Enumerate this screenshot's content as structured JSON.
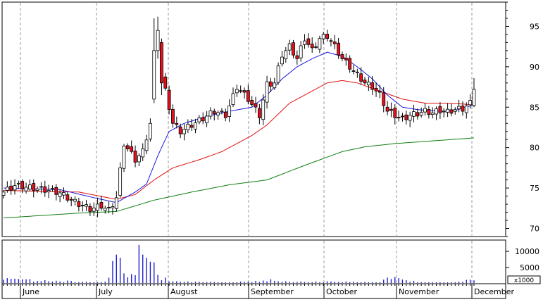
{
  "chart_data": {
    "type": "candlestick",
    "price_axis": {
      "ticks": [
        70,
        75,
        80,
        85,
        90,
        95
      ],
      "ylim": [
        69,
        98
      ]
    },
    "volume_axis": {
      "ticks": [
        5000,
        10000
      ],
      "multiplier_label": "x1000",
      "ylim": [
        0,
        13500
      ]
    },
    "months": [
      "June",
      "July",
      "August",
      "September",
      "October",
      "November",
      "December"
    ],
    "colors": {
      "up": "#ffffff",
      "down": "#e8101c",
      "ma_short": "#1818e0",
      "ma_mid": "#e01010",
      "ma_long": "#108010",
      "volume": "#2020d0",
      "grid": "#9a9a9a"
    },
    "anchors": {
      "close": [
        [
          0,
          74.5
        ],
        [
          3,
          75.3
        ],
        [
          6,
          75.1
        ],
        [
          9,
          74.9
        ],
        [
          12,
          74.7
        ],
        [
          15,
          74.4
        ],
        [
          18,
          73.5
        ],
        [
          20,
          73.0
        ],
        [
          23,
          72.4
        ],
        [
          26,
          72.8
        ],
        [
          28,
          72.2
        ],
        [
          30,
          73.8
        ],
        [
          32,
          80.5
        ],
        [
          35,
          78.5
        ],
        [
          37,
          79.5
        ],
        [
          39,
          83.0
        ],
        [
          40,
          92.0
        ],
        [
          41,
          94.0
        ],
        [
          42,
          89.0
        ],
        [
          43,
          87.0
        ],
        [
          45,
          83.0
        ],
        [
          47,
          82.0
        ],
        [
          50,
          82.8
        ],
        [
          53,
          83.6
        ],
        [
          56,
          84.5
        ],
        [
          59,
          84.0
        ],
        [
          62,
          87.5
        ],
        [
          65,
          86.0
        ],
        [
          68,
          84.0
        ],
        [
          70,
          87.8
        ],
        [
          72,
          88.0
        ],
        [
          74,
          91.5
        ],
        [
          76,
          92.5
        ],
        [
          78,
          91.0
        ],
        [
          80,
          93.5
        ],
        [
          82,
          92.0
        ],
        [
          84,
          93.5
        ],
        [
          86,
          93.8
        ],
        [
          88,
          92.5
        ],
        [
          90,
          91.0
        ],
        [
          92,
          90.0
        ],
        [
          94,
          89.0
        ],
        [
          96,
          88.0
        ],
        [
          98,
          87.5
        ],
        [
          100,
          86.5
        ],
        [
          102,
          84.5
        ],
        [
          104,
          84.0
        ],
        [
          106,
          83.5
        ],
        [
          108,
          84.0
        ],
        [
          110,
          84.2
        ],
        [
          112,
          84.5
        ],
        [
          114,
          84.3
        ],
        [
          116,
          84.6
        ],
        [
          118,
          84.4
        ],
        [
          120,
          84.7
        ],
        [
          122,
          84.8
        ],
        [
          124,
          85.5
        ],
        [
          125,
          87.3
        ]
      ],
      "ma_short": [
        [
          0,
          75.0
        ],
        [
          15,
          74.8
        ],
        [
          25,
          73.7
        ],
        [
          30,
          73.2
        ],
        [
          35,
          74.5
        ],
        [
          38,
          75.5
        ],
        [
          41,
          79.0
        ],
        [
          44,
          82.0
        ],
        [
          48,
          83.0
        ],
        [
          55,
          84.0
        ],
        [
          60,
          84.5
        ],
        [
          66,
          85.0
        ],
        [
          70,
          86.5
        ],
        [
          74,
          88.5
        ],
        [
          78,
          90.0
        ],
        [
          82,
          91.0
        ],
        [
          86,
          91.8
        ],
        [
          90,
          91.3
        ],
        [
          94,
          90.0
        ],
        [
          98,
          88.5
        ],
        [
          102,
          86.5
        ],
        [
          106,
          85.0
        ],
        [
          110,
          84.7
        ],
        [
          116,
          84.5
        ],
        [
          120,
          84.6
        ],
        [
          125,
          85.3
        ]
      ],
      "ma_mid": [
        [
          0,
          74.7
        ],
        [
          20,
          74.5
        ],
        [
          30,
          73.6
        ],
        [
          35,
          74.2
        ],
        [
          40,
          76.0
        ],
        [
          45,
          77.5
        ],
        [
          52,
          78.5
        ],
        [
          58,
          79.5
        ],
        [
          66,
          81.5
        ],
        [
          70,
          82.8
        ],
        [
          76,
          85.5
        ],
        [
          82,
          87.0
        ],
        [
          86,
          88.0
        ],
        [
          90,
          88.3
        ],
        [
          94,
          88.0
        ],
        [
          100,
          87.0
        ],
        [
          106,
          86.0
        ],
        [
          112,
          85.5
        ],
        [
          118,
          85.5
        ],
        [
          125,
          85.3
        ]
      ],
      "ma_long": [
        [
          0,
          71.3
        ],
        [
          20,
          71.9
        ],
        [
          30,
          72.1
        ],
        [
          40,
          73.5
        ],
        [
          50,
          74.5
        ],
        [
          60,
          75.4
        ],
        [
          70,
          76.0
        ],
        [
          80,
          77.8
        ],
        [
          90,
          79.5
        ],
        [
          96,
          80.1
        ],
        [
          104,
          80.5
        ],
        [
          116,
          80.9
        ],
        [
          125,
          81.2
        ]
      ],
      "volume": [
        [
          0,
          1300
        ],
        [
          10,
          900
        ],
        [
          20,
          600
        ],
        [
          26,
          300
        ],
        [
          28,
          1500
        ],
        [
          30,
          9000
        ],
        [
          31,
          7000
        ],
        [
          32,
          4000
        ],
        [
          33,
          2800
        ],
        [
          35,
          2000
        ],
        [
          36,
          12000
        ],
        [
          37,
          9000
        ],
        [
          38,
          8000
        ],
        [
          39,
          6800
        ],
        [
          40,
          5500
        ],
        [
          41,
          3300
        ],
        [
          42,
          1800
        ],
        [
          45,
          600
        ],
        [
          60,
          300
        ],
        [
          70,
          1000
        ],
        [
          80,
          600
        ],
        [
          90,
          500
        ],
        [
          100,
          300
        ],
        [
          102,
          2500
        ],
        [
          110,
          400
        ],
        [
          120,
          300
        ],
        [
          124,
          1500
        ],
        [
          125,
          800
        ]
      ]
    }
  }
}
